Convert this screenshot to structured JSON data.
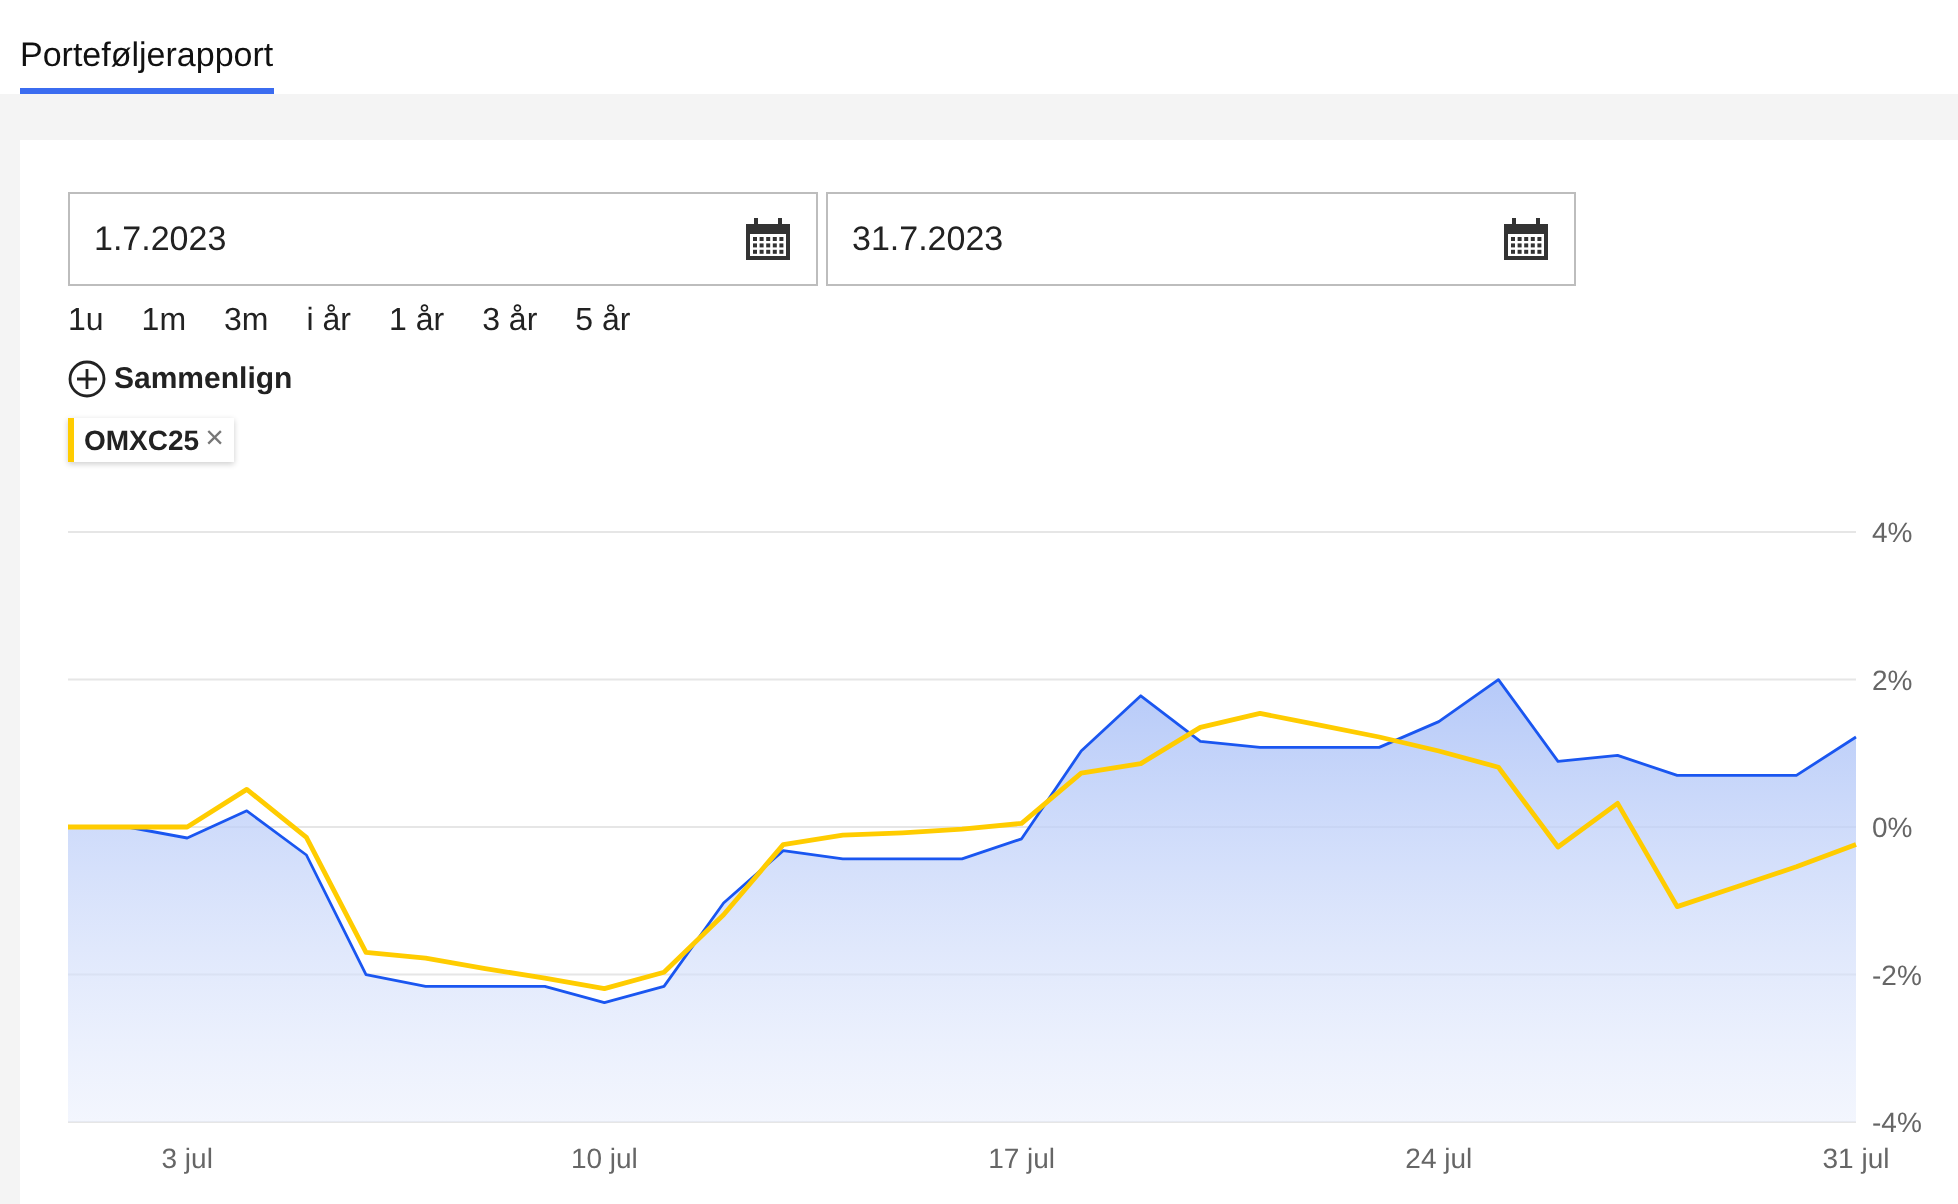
{
  "tabs": [
    {
      "label": "Porteføljerapport",
      "selected": true
    }
  ],
  "date_from": {
    "value": "1.7.2023"
  },
  "date_to": {
    "value": "31.7.2023"
  },
  "periods": [
    "1u",
    "1m",
    "3m",
    "i år",
    "1 år",
    "3 år",
    "5 år"
  ],
  "compare_button": {
    "label": "Sammenlign"
  },
  "compare_chips": [
    {
      "label": "OMXC25",
      "color": "#ffcc00",
      "remove": "×"
    }
  ],
  "chart": {
    "chart_data": {
      "type": "line",
      "grid": true,
      "categories": [
        null,
        null,
        "3 jul",
        null,
        null,
        null,
        null,
        null,
        null,
        "10 jul",
        null,
        null,
        null,
        null,
        null,
        null,
        "17 jul",
        null,
        null,
        null,
        null,
        null,
        null,
        "24 jul",
        null,
        null,
        null,
        null,
        null,
        null,
        "31 jul"
      ],
      "series": [
        {
          "type": "area",
          "color": "#1a56f0",
          "values": [
            0,
            0,
            -0.15,
            0.22,
            -0.38,
            -2.0,
            -2.16,
            -2.16,
            -2.16,
            -2.38,
            -2.16,
            -1.03,
            -0.32,
            -0.43,
            -0.43,
            -0.43,
            -0.16,
            1.03,
            1.78,
            1.16,
            1.08,
            1.08,
            1.08,
            1.43,
            2.0,
            0.89,
            0.97,
            0.7,
            0.7,
            0.7,
            1.22
          ]
        },
        {
          "color": "#ffcc00",
          "values": [
            0,
            0,
            0,
            0.51,
            -0.14,
            -1.7,
            -1.78,
            -1.92,
            -2.05,
            -2.19,
            -1.97,
            -1.19,
            -0.24,
            -0.11,
            -0.08,
            -0.03,
            0.05,
            0.73,
            0.86,
            1.35,
            1.54,
            1.38,
            1.22,
            1.03,
            0.81,
            -0.27,
            0.32,
            -1.08,
            -0.81,
            -0.54,
            -0.24
          ]
        }
      ],
      "ylim": [
        -4,
        4
      ],
      "yticks": [
        {
          "value": 4,
          "label": "4%"
        },
        {
          "value": 2,
          "label": "2%"
        },
        {
          "value": 0,
          "label": "0%"
        },
        {
          "value": -2,
          "label": "-2%"
        },
        {
          "value": -4,
          "label": "-4%"
        }
      ]
    }
  }
}
